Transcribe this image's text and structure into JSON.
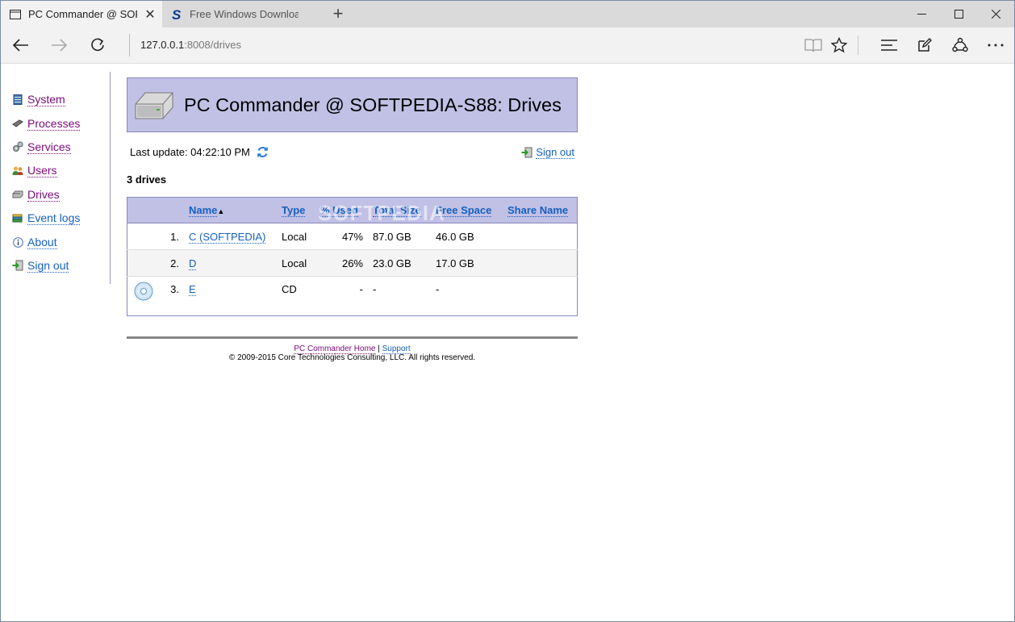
{
  "browser": {
    "tabs": [
      {
        "title": "PC Commander @ SOFT",
        "close": "✕"
      },
      {
        "title": "Free Windows Downloads - S"
      }
    ],
    "new_tab": "+",
    "address": {
      "host": "127.0.0.1",
      "rest": ":8008/drives"
    }
  },
  "sidebar": {
    "items": [
      {
        "label": "System"
      },
      {
        "label": "Processes"
      },
      {
        "label": "Services"
      },
      {
        "label": "Users"
      },
      {
        "label": "Drives"
      },
      {
        "label": "Event logs"
      },
      {
        "label": "About"
      },
      {
        "label": "Sign out"
      }
    ]
  },
  "page": {
    "title": "PC Commander @ SOFTPEDIA-S88: Drives",
    "last_update_label": "Last update: 04:22:10 PM",
    "sign_out": "Sign out",
    "drive_count": "3 drives",
    "watermark": "SOFTPEDIA"
  },
  "table": {
    "headers": [
      "Name",
      "Type",
      "% Used",
      "Total Size",
      "Free Space",
      "Share Name"
    ],
    "sort_indicator": "▲",
    "rows": [
      {
        "index": "1.",
        "name": "C (SOFTPEDIA)",
        "type": "Local",
        "used": "47%",
        "total": "87.0 GB",
        "free": "46.0 GB",
        "share": ""
      },
      {
        "index": "2.",
        "name": "D",
        "type": "Local",
        "used": "26%",
        "total": "23.0 GB",
        "free": "17.0 GB",
        "share": ""
      },
      {
        "index": "3.",
        "name": "E",
        "type": "CD",
        "used": "-",
        "total": "-",
        "free": "-",
        "share": ""
      }
    ]
  },
  "footer": {
    "home_link": "PC Commander Home",
    "sep": "|",
    "support_link": "Support",
    "copyright": "© 2009-2015 Core Technologies Consulting, LLC. All rights reserved."
  },
  "colors": {
    "banner_bg": "#c1c1e6",
    "link_blue": "#1560bd",
    "link_visited": "#7a0a7a"
  }
}
